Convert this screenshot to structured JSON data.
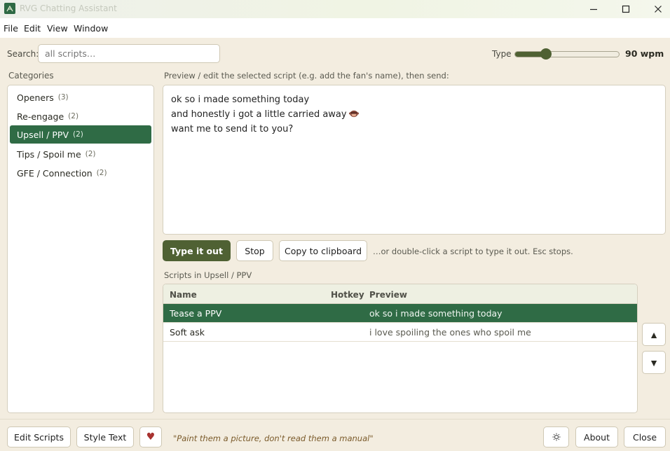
{
  "window": {
    "title": "RVG Chatting Assistant",
    "controls": {
      "minimize": "minimize",
      "maximize": "maximize",
      "close": "close"
    }
  },
  "menu": [
    "File",
    "Edit",
    "View",
    "Window"
  ],
  "search": {
    "label": "Search:",
    "placeholder": "all scripts…",
    "value": ""
  },
  "typing": {
    "label": "Type",
    "speed_value": 90,
    "speed_min": 0,
    "speed_max": 300,
    "speed_text": "90 wpm"
  },
  "categories": {
    "label": "Categories",
    "items": [
      {
        "name": "Openers",
        "count": "(3)",
        "active": false
      },
      {
        "name": "Re-engage",
        "count": "(2)",
        "active": false
      },
      {
        "name": "Upsell / PPV",
        "count": "(2)",
        "active": true
      },
      {
        "name": "Tips / Spoil me",
        "count": "(2)",
        "active": false
      },
      {
        "name": "GFE / Connection",
        "count": "(2)",
        "active": false
      }
    ]
  },
  "preview": {
    "label": "Preview / edit the selected script (e.g. add the fan's name), then send:",
    "lines": [
      "ok so i made something today",
      "and honestly i got a little carried away",
      "want me to send it to you?"
    ],
    "emoji_icon": "see-no-evil-monkey-icon"
  },
  "actions": {
    "type_it_out": "Type it out",
    "stop": "Stop",
    "copy": "Copy to clipboard",
    "hint": "…or double-click a script to type it out. Esc stops."
  },
  "scripts": {
    "label": "Scripts in Upsell / PPV",
    "columns": {
      "name": "Name",
      "hotkey": "Hotkey",
      "preview": "Preview"
    },
    "rows": [
      {
        "name": "Tease a PPV",
        "hotkey": "",
        "preview": "ok so i made something today",
        "selected": true
      },
      {
        "name": "Soft ask",
        "hotkey": "",
        "preview": "i love spoiling the ones who spoil me",
        "selected": false
      }
    ],
    "move_up": "▲",
    "move_down": "▼"
  },
  "footer": {
    "edit_scripts": "Edit Scripts",
    "style_text": "Style Text",
    "heart": "♥",
    "quote": "\"Paint them a picture, don't read them a manual\"",
    "settings_icon": "sun-icon",
    "about": "About",
    "close": "Close"
  },
  "colors": {
    "accent_green": "#2f6b45",
    "primary_olive": "#4f6133",
    "background": "#f3ede0",
    "heart": "#a8322f",
    "quote": "#7a5a2a"
  }
}
